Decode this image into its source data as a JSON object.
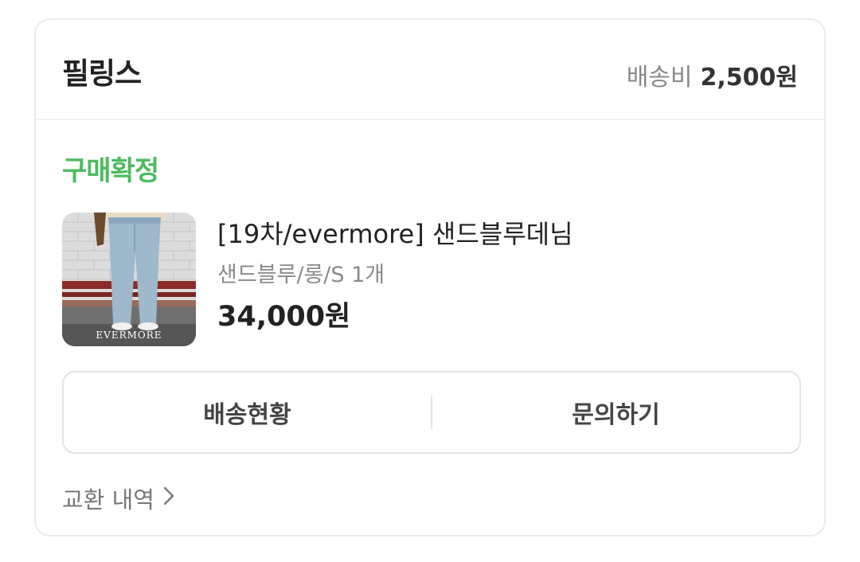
{
  "store": {
    "name": "필링스",
    "shipping_label": "배송비",
    "shipping_fee": "2,500원"
  },
  "order": {
    "status": "구매확정",
    "status_color": "#4cbb5e"
  },
  "product": {
    "title": "[19차/evermore] 샌드블루데님",
    "option": "샌드블루/롱/S 1개",
    "price": "34,000원",
    "thumbnail_caption": "EVERMORE"
  },
  "actions": {
    "track_delivery": "배송현황",
    "inquiry": "문의하기"
  },
  "exchange": {
    "label": "교환 내역",
    "icon": "chevron-right-icon"
  }
}
